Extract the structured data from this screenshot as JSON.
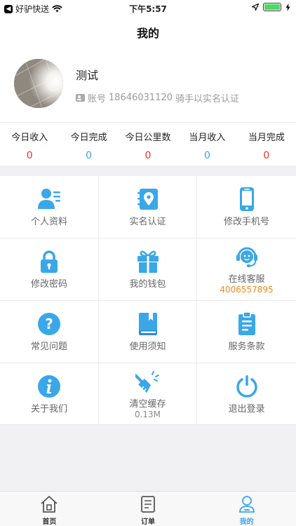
{
  "status_bar": {
    "carrier": "好驴快送",
    "time": "下午5:57",
    "battery_percent": 100
  },
  "nav": {
    "title": "我的"
  },
  "profile": {
    "name": "测试",
    "account_label": "账号",
    "account_number": "18646031120",
    "status": "骑手以实名认证"
  },
  "stats": [
    {
      "label": "今日收入",
      "value": "0",
      "color": "#e8312d"
    },
    {
      "label": "今日完成",
      "value": "0",
      "color": "#3aa7e8"
    },
    {
      "label": "今日公里数",
      "value": "0",
      "color": "#e8312d"
    },
    {
      "label": "当月收入",
      "value": "0",
      "color": "#3aa7e8"
    },
    {
      "label": "当月完成",
      "value": "0",
      "color": "#e8312d"
    }
  ],
  "menu": [
    {
      "id": "profile-info",
      "label": "个人资料",
      "icon": "user-card-icon"
    },
    {
      "id": "real-name-auth",
      "label": "实名认证",
      "icon": "location-book-icon"
    },
    {
      "id": "change-phone",
      "label": "修改手机号",
      "icon": "phone-icon"
    },
    {
      "id": "change-password",
      "label": "修改密码",
      "icon": "lock-icon"
    },
    {
      "id": "wallet",
      "label": "我的钱包",
      "icon": "gift-icon"
    },
    {
      "id": "customer-service",
      "label": "在线客服",
      "sub": "4006557895",
      "icon": "headset-icon"
    },
    {
      "id": "faq",
      "label": "常见问题",
      "icon": "question-icon"
    },
    {
      "id": "usage-notice",
      "label": "使用须知",
      "icon": "book-icon"
    },
    {
      "id": "terms",
      "label": "服务条款",
      "icon": "clipboard-icon"
    },
    {
      "id": "about",
      "label": "关于我们",
      "icon": "info-icon"
    },
    {
      "id": "clear-cache",
      "label": "清空缓存",
      "sub": "0.13M",
      "icon": "broom-icon"
    },
    {
      "id": "logout",
      "label": "退出登录",
      "icon": "power-icon"
    }
  ],
  "tabs": [
    {
      "label": "首页",
      "icon": "home-icon"
    },
    {
      "label": "订单",
      "icon": "order-icon"
    },
    {
      "label": "我的",
      "icon": "me-icon",
      "active": true
    }
  ],
  "colors": {
    "icon_blue": "#3aa7e8",
    "accent_orange": "#f08a1c",
    "stat_red": "#e8312d",
    "tab_active": "#3aa7e8",
    "tab_inactive": "#555555"
  }
}
